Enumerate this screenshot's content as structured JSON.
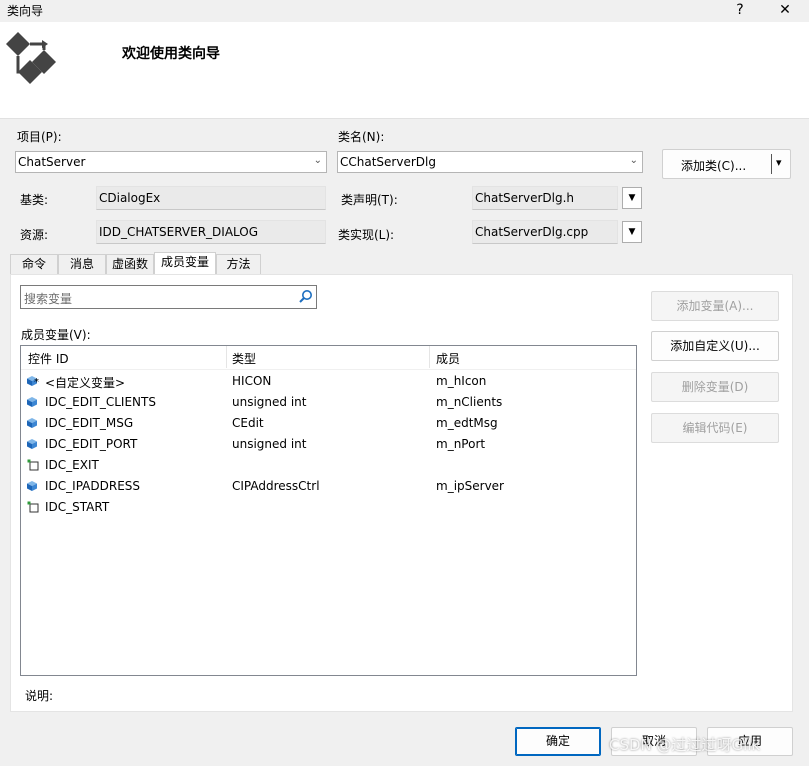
{
  "window": {
    "title": "类向导",
    "help_label": "?",
    "close_label": "✕"
  },
  "header": {
    "title": "欢迎使用类向导",
    "logo_icon": "class-wizard-icon"
  },
  "project": {
    "label": "项目(P):",
    "value": "ChatServer"
  },
  "classname": {
    "label": "类名(N):",
    "value": "CChatServerDlg"
  },
  "add_class": {
    "label": "添加类(C)...",
    "arrow": "▾"
  },
  "base": {
    "label": "基类:",
    "value": "CDialogEx"
  },
  "resource": {
    "label": "资源:",
    "value": "IDD_CHATSERVER_DIALOG"
  },
  "declaration": {
    "label": "类声明(T):",
    "value": "ChatServerDlg.h"
  },
  "implementation": {
    "label": "类实现(L):",
    "value": "ChatServerDlg.cpp"
  },
  "tabs": [
    {
      "label": "命令"
    },
    {
      "label": "消息"
    },
    {
      "label": "虚函数"
    },
    {
      "label": "成员变量",
      "active": true
    },
    {
      "label": "方法"
    }
  ],
  "search": {
    "placeholder": "搜索变量"
  },
  "member_vars_label": "成员变量(V):",
  "table": {
    "columns": [
      "控件 ID",
      "类型",
      "成员"
    ],
    "rows": [
      {
        "id": "<自定义变量>",
        "type": "HICON",
        "member": "m_hIcon",
        "icon": "custom-variable-icon"
      },
      {
        "id": "IDC_EDIT_CLIENTS",
        "type": "unsigned int",
        "member": "m_nClients",
        "icon": "variable-icon"
      },
      {
        "id": "IDC_EDIT_MSG",
        "type": "CEdit",
        "member": "m_edtMsg",
        "icon": "variable-icon"
      },
      {
        "id": "IDC_EDIT_PORT",
        "type": "unsigned int",
        "member": "m_nPort",
        "icon": "variable-icon"
      },
      {
        "id": "IDC_EXIT",
        "type": "",
        "member": "",
        "icon": "control-icon"
      },
      {
        "id": "IDC_IPADDRESS",
        "type": "CIPAddressCtrl",
        "member": "m_ipServer",
        "icon": "variable-icon"
      },
      {
        "id": "IDC_START",
        "type": "",
        "member": "",
        "icon": "control-icon"
      }
    ]
  },
  "buttons": {
    "add_variable": "添加变量(A)...",
    "add_custom": "添加自定义(U)...",
    "delete_variable": "删除变量(D)",
    "edit_code": "编辑代码(E)"
  },
  "description_label": "说明:",
  "footer": {
    "ok": "确定",
    "cancel": "取消",
    "apply": "应用"
  },
  "watermark": "CSDN @过过过呀Glik"
}
